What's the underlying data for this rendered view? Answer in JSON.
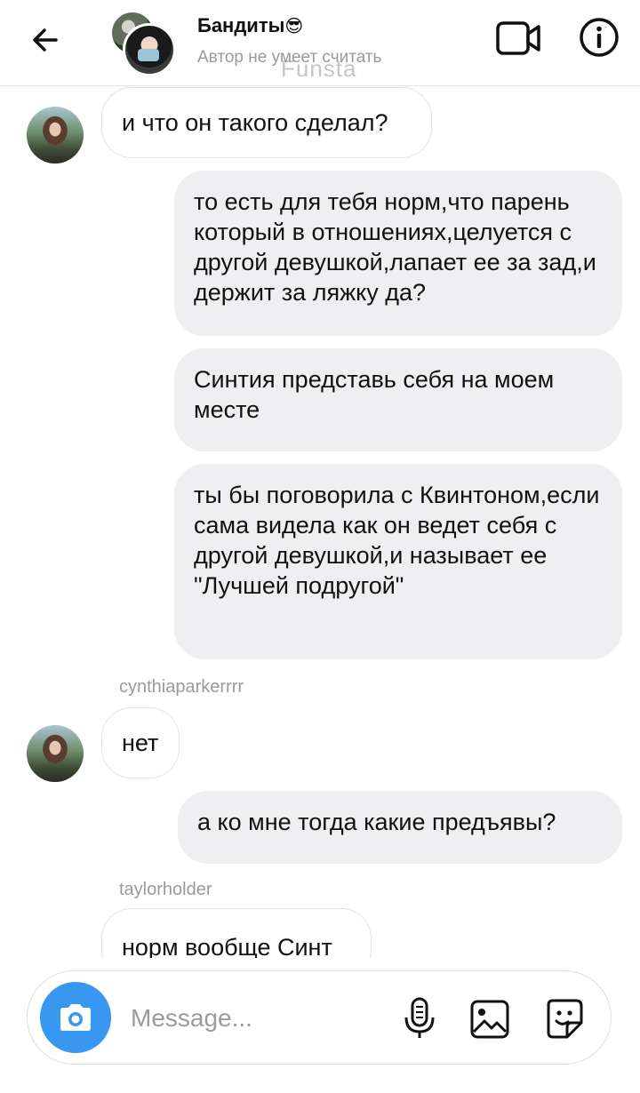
{
  "header": {
    "title": "Бандиты",
    "title_emoji": "😎",
    "subtitle": "Автор не умеет считать",
    "watermark": "Funsta"
  },
  "messages": [
    {
      "direction": "in",
      "text": "и что он такого сделал?"
    },
    {
      "direction": "out",
      "text": "то есть для тебя норм,что парень который в отношениях,целуется с другой девушкой,лапает ее за зад,и держит за ляжку да?"
    },
    {
      "direction": "out",
      "text": "Синтия представь себя на моем месте"
    },
    {
      "direction": "out",
      "text": "ты бы поговорила с Квинтоном,если сама видела как он ведет себя с другой девушкой,и называет ее \"Лучшей подругой\""
    },
    {
      "direction": "in",
      "sender": "cynthiaparkerrrr",
      "text": "нет"
    },
    {
      "direction": "out",
      "text": "а ко мне тогда какие предъявы?"
    },
    {
      "direction": "in",
      "sender": "taylorholder",
      "text": "норм вообще Синт"
    }
  ],
  "composer": {
    "placeholder": "Message..."
  },
  "colors": {
    "accent": "#3897f0",
    "bubble_out": "#efeff1",
    "bubble_in_border": "#e3e3e3",
    "muted_text": "#9a9a9a"
  },
  "icons": [
    "back-arrow-icon",
    "video-camera-icon",
    "info-icon",
    "camera-icon",
    "microphone-icon",
    "gallery-icon",
    "sticker-icon"
  ]
}
